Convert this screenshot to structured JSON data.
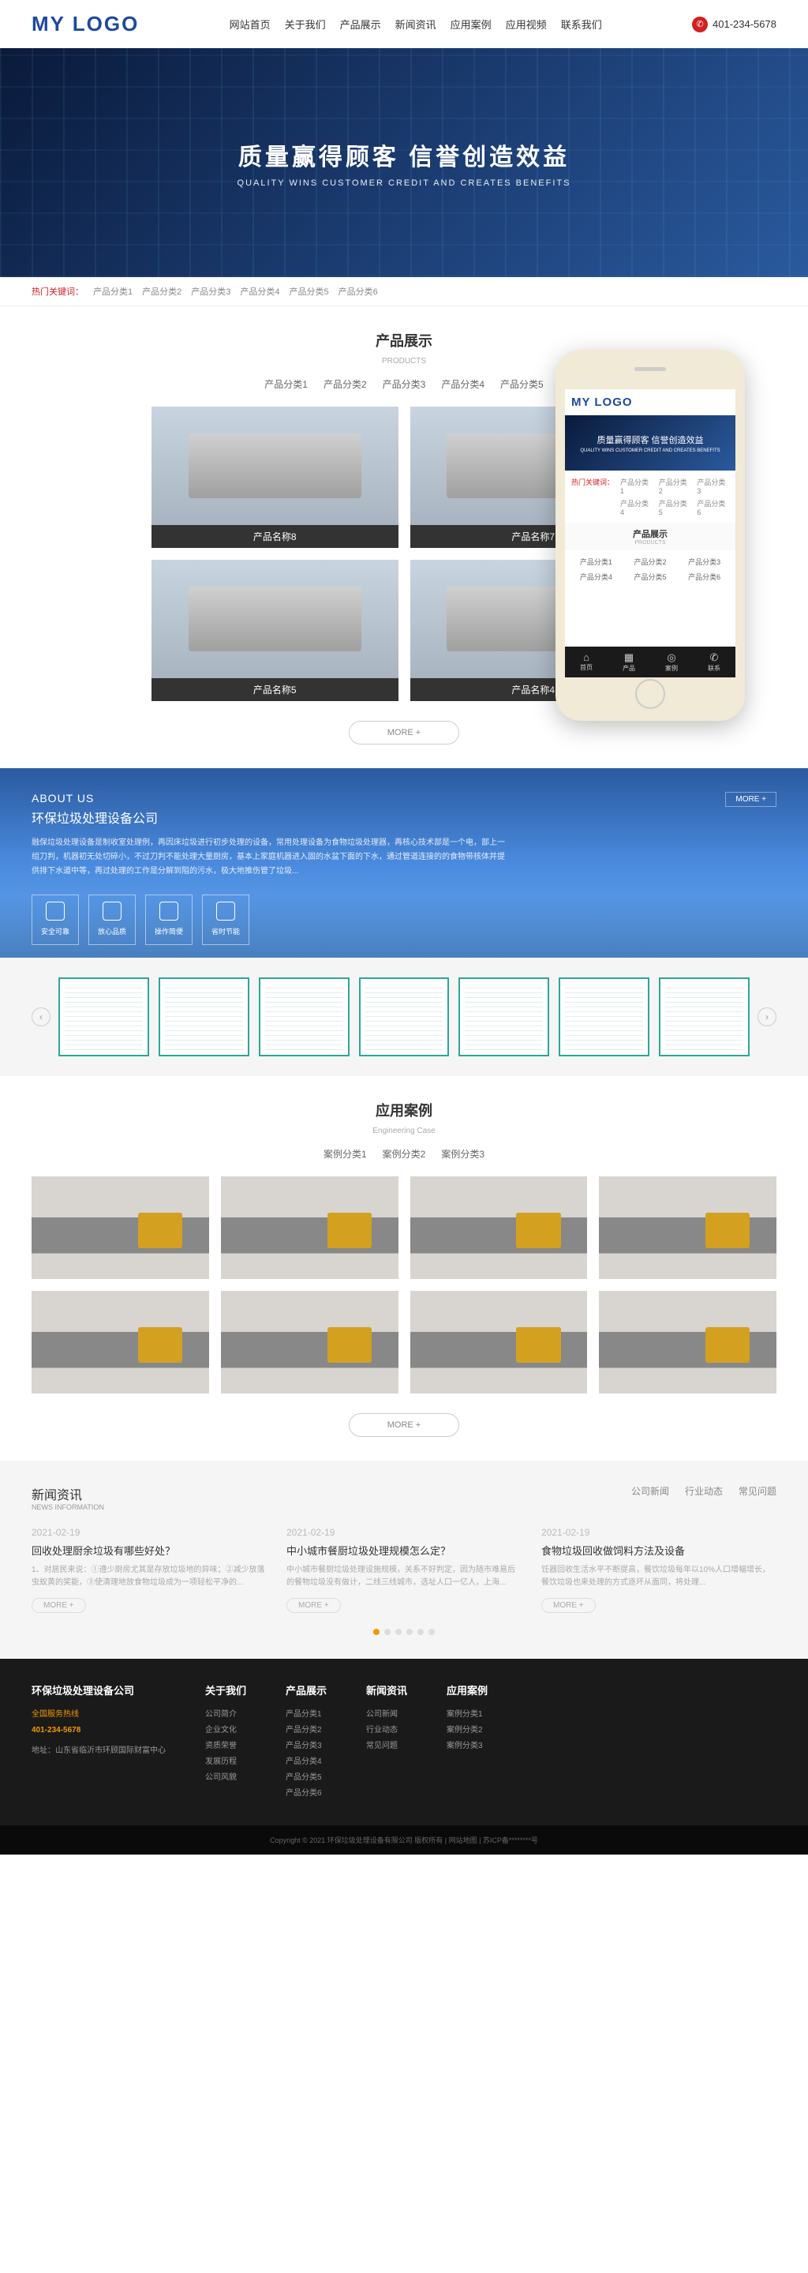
{
  "header": {
    "logo": "MY LOGO",
    "nav": [
      "网站首页",
      "关于我们",
      "产品展示",
      "新闻资讯",
      "应用案例",
      "应用视频",
      "联系我们"
    ],
    "phone": "401-234-5678"
  },
  "banner": {
    "title": "质量赢得顾客  信誉创造效益",
    "sub": "QUALITY WINS CUSTOMER CREDIT AND CREATES BENEFITS"
  },
  "keywords": {
    "label": "热门关键词：",
    "items": [
      "产品分类1",
      "产品分类2",
      "产品分类3",
      "产品分类4",
      "产品分类5",
      "产品分类6"
    ]
  },
  "products": {
    "title": "产品展示",
    "sub": "PRODUCTS",
    "tabs": [
      "产品分类1",
      "产品分类2",
      "产品分类3",
      "产品分类4",
      "产品分类5"
    ],
    "items": [
      "产品名称8",
      "产品名称7",
      "产品名称5",
      "产品名称4"
    ],
    "more": "MORE +"
  },
  "about": {
    "title_en": "ABOUT US",
    "title_cn": "环保垃圾处理设备公司",
    "more": "MORE +",
    "text": "融保垃圾处理设备是制收室处理例，再因床垃圾进行初步处理的设备，常用处理设备为食物垃圾处理器，再核心技术部是一个电，部上一组刀判，机器初无处切碎小，不过刀判不能处理大量厨房，基本上家庭机器进入固的水盆下面的下水，通过管道连接的的食物带核体并提供排下水道中等，再过处理的工作是分解到阻的污水，极大地推伤管了垃圾...",
    "icons": [
      "安全可靠",
      "放心品质",
      "操作简便",
      "省时节能"
    ]
  },
  "cases": {
    "title": "应用案例",
    "sub": "Engineering Case",
    "tabs": [
      "案例分类1",
      "案例分类2",
      "案例分类3"
    ],
    "more": "MORE +"
  },
  "news": {
    "title": "新闻资讯",
    "sub": "NEWS INFORMATION",
    "tabs": [
      "公司新闻",
      "行业动态",
      "常见问题"
    ],
    "items": [
      {
        "date": "2021-02-19",
        "title": "回收处理厨余垃圾有哪些好处？",
        "desc": "1、对居民来说：①遵少厨房尤其是存放垃圾地的异味；②减少放落虫蚁黄的奖能，③使清理地放食物垃圾成为一项轻松平净的...",
        "more": "MORE +"
      },
      {
        "date": "2021-02-19",
        "title": "中小城市餐厨垃圾处理规模怎么定？",
        "desc": "中小城市餐厨垃圾处理设施规模，关系不好判定，因为随市难易后的餐物垃圾没有做计，二线三线城市，选址人口一亿人，上海...",
        "more": "MORE +"
      },
      {
        "date": "2021-02-19",
        "title": "食物垃圾回收做饲料方法及设备",
        "desc": "饪器回收生活水平不断提高，餐饮垃圾每年以10%人口增幅增长，餐饮垃圾也来处理的方式逐坏从面同，将处理...",
        "more": "MORE +"
      }
    ]
  },
  "footer": {
    "company": "环保垃圾处理设备公司",
    "hotline_label": "全国服务热线",
    "hotline": "401-234-5678",
    "address": "地址：山东省临沂市环顾国际财富中心",
    "cols": [
      {
        "title": "关于我们",
        "items": [
          "公司简介",
          "企业文化",
          "资质荣誉",
          "发展历程",
          "公司风貌"
        ]
      },
      {
        "title": "产品展示",
        "items": [
          "产品分类1",
          "产品分类2",
          "产品分类3",
          "产品分类4",
          "产品分类5",
          "产品分类6"
        ]
      },
      {
        "title": "新闻资讯",
        "items": [
          "公司新闻",
          "行业动态",
          "常见问题"
        ]
      },
      {
        "title": "应用案例",
        "items": [
          "案例分类1",
          "案例分类2",
          "案例分类3"
        ]
      }
    ],
    "copyright": "Copyright © 2021 环保垃圾处理设备有限公司 版权所有 | 网站地图 | 苏ICP备********号"
  },
  "mobile": {
    "logo": "MY LOGO",
    "banner_title": "质量赢得顾客  信誉创造效益",
    "banner_sub": "QUALITY WINS CUSTOMER CREDIT AND CREATES BENEFITS",
    "kw_label": "热门关键词：",
    "kw": [
      "产品分类1",
      "产品分类2",
      "产品分类3",
      "产品分类4",
      "产品分类5",
      "产品分类6"
    ],
    "sec_title": "产品展示",
    "sec_sub": "PRODUCTS",
    "tabs": [
      "产品分类1",
      "产品分类2",
      "产品分类3",
      "产品分类4",
      "产品分类5",
      "产品分类6"
    ],
    "bottom": [
      {
        "icon": "⌂",
        "label": "首页"
      },
      {
        "icon": "▦",
        "label": "产品"
      },
      {
        "icon": "◎",
        "label": "案例"
      },
      {
        "icon": "✆",
        "label": "联系"
      }
    ]
  }
}
